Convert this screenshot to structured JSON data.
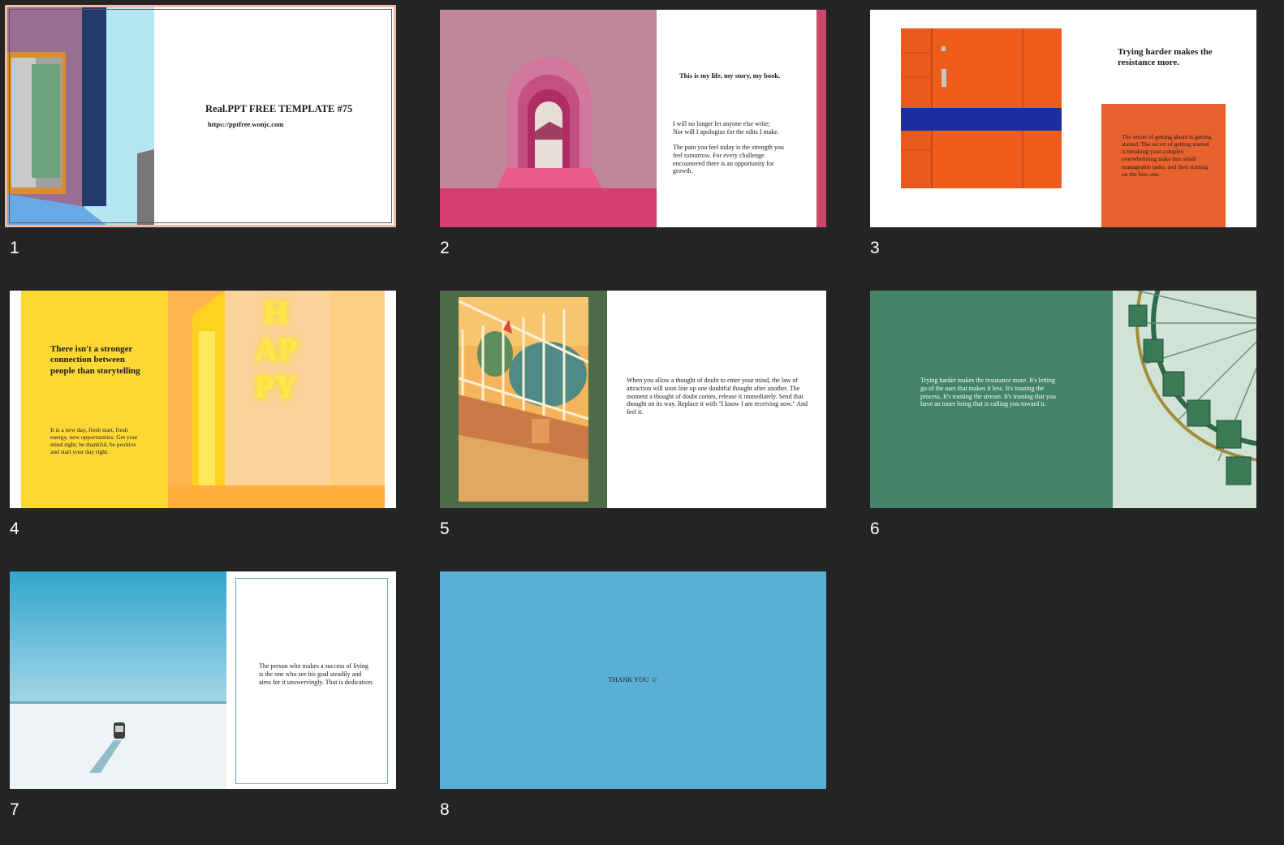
{
  "slides": [
    {
      "number": "1",
      "title": "Real.PPT FREE TEMPLATE #75",
      "url": "https://pptfree.wonjc.com"
    },
    {
      "number": "2",
      "heading": "This is my life, my story, my book.",
      "line1": "I will no longer let anyone else write;",
      "line2": "Nor will I apologize for the edits I make.",
      "para": "The pain you feel today is the strength you feel tomorrow. For every challenge encountered there is an opportunity for growth."
    },
    {
      "number": "3",
      "heading": "Trying harder makes the resistance more.",
      "box_text": "The secret of getting ahead is getting started. The secret of getting started is breaking your complex overwhelming tasks into small manageable tasks, and then starting on the first one."
    },
    {
      "number": "4",
      "heading": "There isn't a stronger connection between people than storytelling",
      "para": "It is a new day, fresh start, fresh energy, new opportunities. Get your mind right, be thankful, be positive and start your day right.",
      "neon": "HAPPY"
    },
    {
      "number": "5",
      "para": "When you allow a thought of doubt to enter your mind, the law of attraction will soon line up one doubtful thought after another. The moment a thought of doubt comes, release it immediately. Send that thought on its way. Replace it with \"I know I am receiving now.\" And feel it."
    },
    {
      "number": "6",
      "para": "Trying harder makes the resistance more. It's letting go of the oars that makes it less. It's trusting the process. It's trusting the stream. It's trusting that you have an inner being that is calling you toward it."
    },
    {
      "number": "7",
      "para": "The person who makes a success of living is the one who see his goal steadily and aims for it unswervingly. That is dedication."
    },
    {
      "number": "8",
      "text": "THANK YOU ☺"
    }
  ],
  "colors": {
    "background": "#242424",
    "selection": "#f4b9a2",
    "slide2_accent": "#c8486a",
    "slide3_orange": "#e8622f",
    "slide4_yellow": "#fdd835",
    "slide5_green": "#4d6b48",
    "slide6_green": "#43846a",
    "slide8_blue": "#5aafd6"
  }
}
